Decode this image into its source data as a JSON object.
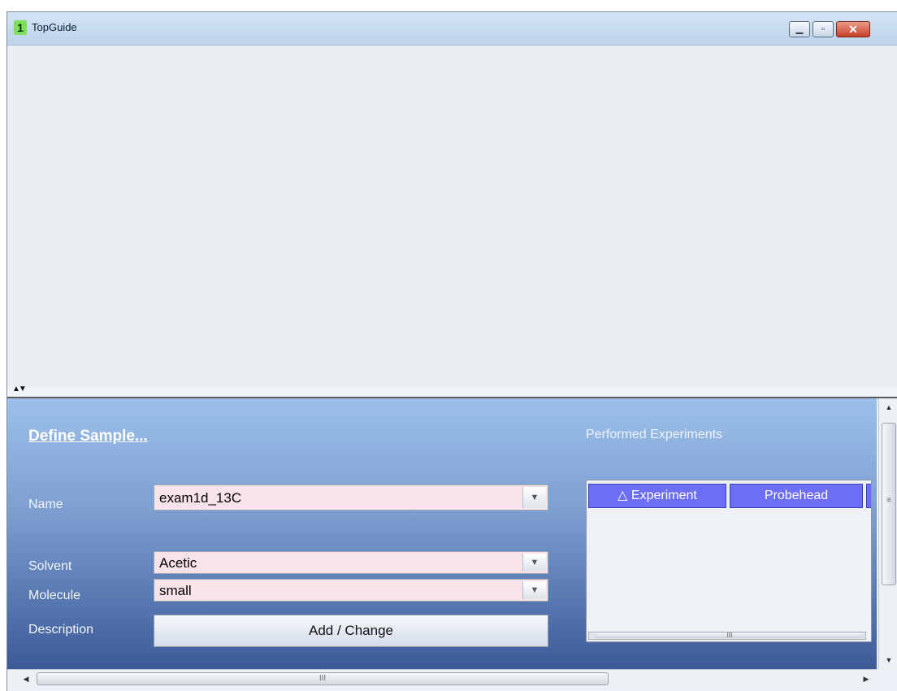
{
  "window": {
    "badge": "1",
    "title": "TopGuide",
    "controls": {
      "minimize_icon": "minimize-icon",
      "maximize_icon": "maximize-icon",
      "close_icon": "close-icon"
    }
  },
  "splitter": {
    "icon": "split-arrows-icon",
    "glyph": "▲▼"
  },
  "sample": {
    "define_link": "Define Sample...",
    "fields": {
      "name": {
        "label": "Name",
        "value": "exam1d_13C"
      },
      "solvent": {
        "label": "Solvent",
        "value": "Acetic"
      },
      "molecule": {
        "label": "Molecule",
        "value": "small"
      },
      "description": {
        "label": "Description",
        "button": "Add / Change"
      }
    }
  },
  "experiments": {
    "title": "Performed Experiments",
    "columns": [
      "△ Experiment",
      "Probehead"
    ]
  },
  "colors": {
    "panel_top": "#9cc0ea",
    "panel_bottom": "#3c5a98",
    "header_blue": "#6c6ef5",
    "field_pink": "#f8e4e8",
    "app_badge": "#7ee05a",
    "close_red": "#c6412a"
  }
}
